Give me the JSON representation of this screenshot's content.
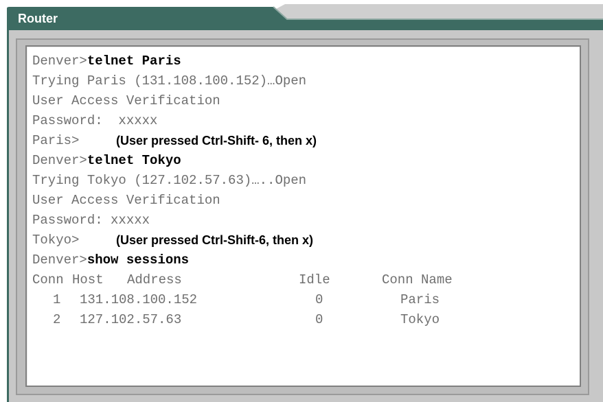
{
  "window": {
    "title": "Router"
  },
  "colors": {
    "tab": "#3d6b62",
    "frame": "#c8c8c8",
    "terminal_bg": "#ffffff",
    "output_text": "#6f6f6f"
  },
  "terminal": {
    "lines": [
      {
        "prompt": "Denver>",
        "command": "telnet Paris"
      },
      {
        "text": "Trying Paris (131.108.100.152)…Open"
      },
      {
        "text": "User Access Verification"
      },
      {
        "text": "Password:  xxxxx"
      },
      {
        "prompt": "Paris>",
        "note": "(User pressed Ctrl-Shift- 6, then x)"
      },
      {
        "prompt": "Denver>",
        "command": "telnet Tokyo"
      },
      {
        "text": "Trying Tokyo (127.102.57.63)…..Open"
      },
      {
        "text": "User Access Verification"
      },
      {
        "text": "Password: xxxxx"
      },
      {
        "prompt": "Tokyo>",
        "note": "(User pressed Ctrl-Shift-6, then x)"
      },
      {
        "prompt": "Denver>",
        "command": "show sessions"
      }
    ],
    "sessions_table": {
      "headers": [
        "Conn",
        "Host",
        "Address",
        "Idle",
        "Conn Name"
      ],
      "rows": [
        {
          "conn": "1",
          "address": "131.108.100.152",
          "idle": "0",
          "name": "Paris"
        },
        {
          "conn": "2",
          "address": "127.102.57.63",
          "idle": "0",
          "name": "Tokyo"
        }
      ]
    }
  }
}
